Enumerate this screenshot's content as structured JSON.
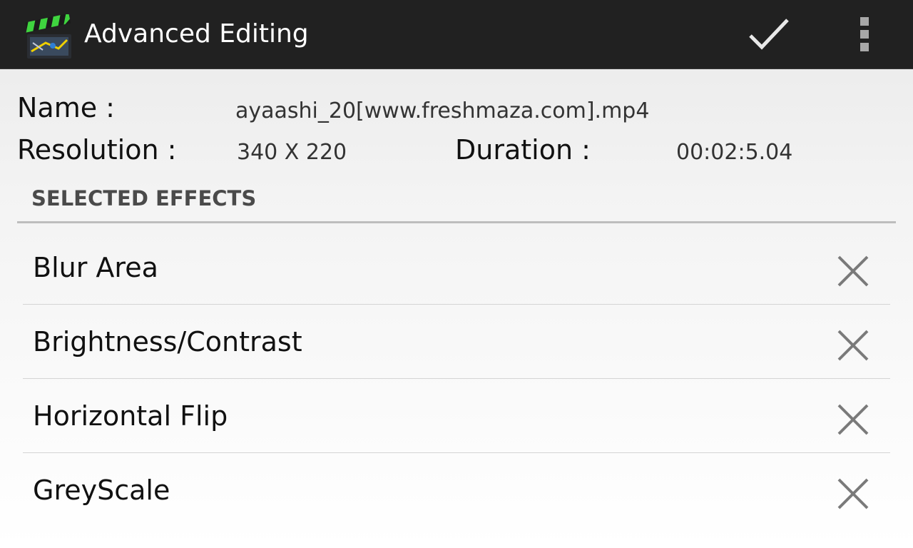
{
  "action_bar": {
    "title": "Advanced Editing",
    "app_icon": "clapperboard-icon",
    "confirm_icon": "checkmark-icon",
    "overflow_icon": "overflow-menu-icon",
    "background_color": "#212121"
  },
  "video_info": {
    "name_label": "Name :",
    "name_value": "ayaashi_20[www.freshmaza.com].mp4",
    "resolution_label": "Resolution :",
    "resolution_value": "340 X 220",
    "duration_label": "Duration :",
    "duration_value": "00:02:5.04"
  },
  "effects": {
    "header": "SELECTED EFFECTS",
    "remove_icon": "close-icon",
    "items": [
      {
        "label": "Blur Area"
      },
      {
        "label": "Brightness/Contrast"
      },
      {
        "label": "Horizontal Flip"
      },
      {
        "label": "GreyScale"
      }
    ]
  }
}
